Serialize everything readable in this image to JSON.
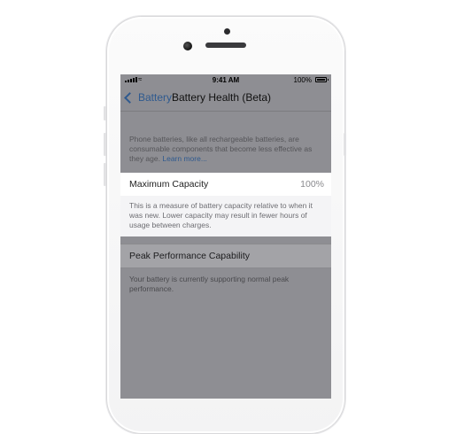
{
  "status_bar": {
    "time": "9:41 AM",
    "battery_percent": "100%"
  },
  "nav": {
    "back_label": "Battery",
    "title": "Battery Health (Beta)"
  },
  "intro": {
    "text": "Phone batteries, like all rechargeable batteries, are consumable components that become less effective as they age.",
    "link": "Learn more..."
  },
  "max_capacity": {
    "label": "Maximum Capacity",
    "value": "100%",
    "footnote": "This is a measure of battery capacity relative to when it was new. Lower capacity may result in fewer hours of usage between charges."
  },
  "peak_performance": {
    "label": "Peak Performance Capability",
    "footnote": "Your battery is currently supporting normal peak performance."
  },
  "colors": {
    "accent": "#2f5a8f",
    "dim_overlay": "#8e8e93"
  }
}
